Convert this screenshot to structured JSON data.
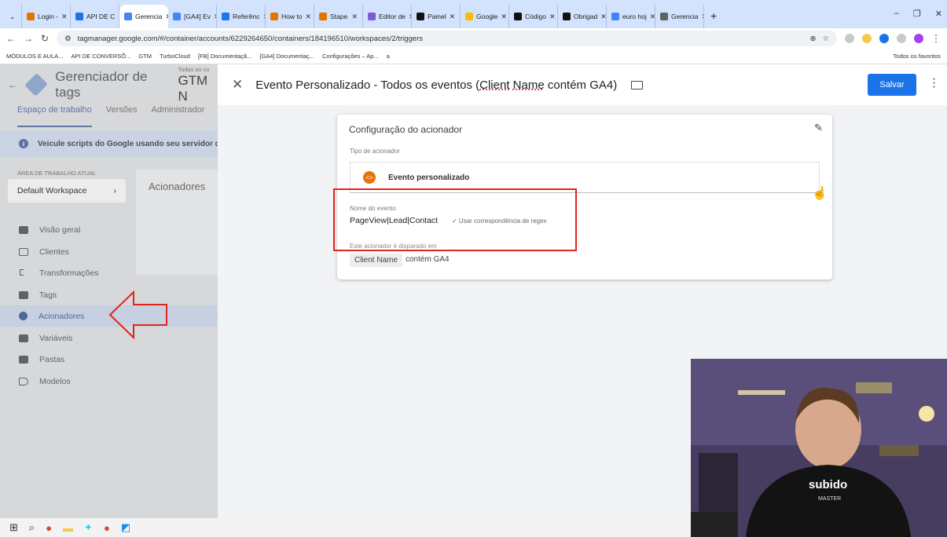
{
  "browser": {
    "tabs": [
      {
        "label": "Login - ",
        "color": "#e37400"
      },
      {
        "label": "API DE C",
        "color": "#1a73e8"
      },
      {
        "label": "Gerencia",
        "color": "#4285f4"
      },
      {
        "label": "[GA4] Ev",
        "color": "#4285f4"
      },
      {
        "label": "Referênc",
        "color": "#1877f2"
      },
      {
        "label": "How to",
        "color": "#e37400"
      },
      {
        "label": "Stape",
        "color": "#e37400"
      },
      {
        "label": "Editor de",
        "color": "#7b5cd6"
      },
      {
        "label": "Painel",
        "color": "#111111"
      },
      {
        "label": "Google",
        "color": "#fbbc04"
      },
      {
        "label": "Código",
        "color": "#111111"
      },
      {
        "label": "Obrigad",
        "color": "#111111"
      },
      {
        "label": "euro hoj",
        "color": "#4285f4"
      },
      {
        "label": "Gerencia",
        "color": "#5f6368"
      }
    ],
    "active_tab_index": 2,
    "url": "tagmanager.google.com/#/container/accounts/6229264650/containers/184196510/workspaces/2/triggers",
    "bookmarks": [
      "MÓDULOS E AULA...",
      "API DE CONVERSÕ...",
      "GTM",
      "TurboCloud",
      "[FB] Documentaçã...",
      "[GA4] Documentaç...",
      "Configurações – Ap...",
      "a"
    ],
    "bookmarks_right": "Todos os favoritos"
  },
  "gtm": {
    "title": "Gerenciador de tags",
    "account_small": "Todas as co",
    "account_big": "GTM N",
    "tabs": [
      "Espaço de trabalho",
      "Versões",
      "Administrador"
    ],
    "banner": "Veicule scripts do Google usando seu servidor de",
    "workspace_label": "ÁREA DE TRABALHO ATUAL",
    "workspace_name": "Default Workspace",
    "acionadores_card": "Acionadores",
    "nav": [
      {
        "label": "Visão geral",
        "icon": "briefcase-icon"
      },
      {
        "label": "Clientes",
        "icon": "client-icon"
      },
      {
        "label": "Transformações",
        "icon": "transform-icon"
      },
      {
        "label": "Tags",
        "icon": "tag-icon"
      },
      {
        "label": "Acionadores",
        "icon": "trigger-icon",
        "active": true
      },
      {
        "label": "Variáveis",
        "icon": "variable-icon"
      },
      {
        "label": "Pastas",
        "icon": "folder-icon"
      },
      {
        "label": "Modelos",
        "icon": "template-icon"
      }
    ]
  },
  "trigger": {
    "title_pre": "Evento Personalizado - Todos os eventos (",
    "title_u1": "Client",
    "title_sp": " ",
    "title_u2": "Name",
    "title_post": " contém GA4)",
    "save": "Salvar",
    "card_title": "Configuração do acionador",
    "type_label": "Tipo de acionador",
    "type_value": "Evento personalizado",
    "event_label": "Nome do evento",
    "event_name": "PageView|Lead|Contact",
    "regex": "✓  Usar correspondência de regex",
    "fired_label": "Este acionador é disparado em",
    "cond_var": "Client Name",
    "cond_op": "contém GA4"
  },
  "annotation_color": "#e1251b",
  "accent": "#1a73e8"
}
